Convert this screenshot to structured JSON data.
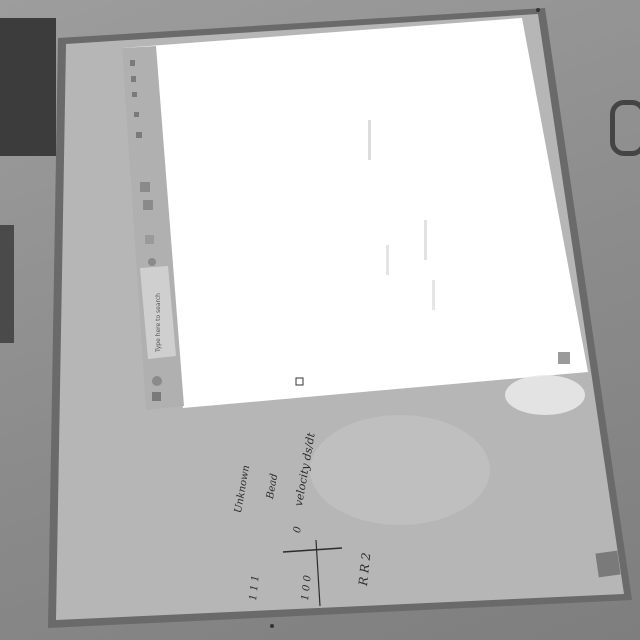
{
  "scene": {
    "description_colors": {
      "background": "#8f8f8f",
      "whiteboard": "#b4b4b4",
      "projection": "#ffffff",
      "taskbar": "#a8a8a8",
      "marker_ink": "#2c2c2c"
    }
  },
  "projection": {
    "taskbar_labels": [
      "Type here to search"
    ]
  },
  "handwriting": {
    "lines": [
      "velocity ds/dt",
      "R   R   2",
      "Unknown",
      "Bead",
      "0",
      "1   0   0",
      "1   1   1"
    ]
  }
}
